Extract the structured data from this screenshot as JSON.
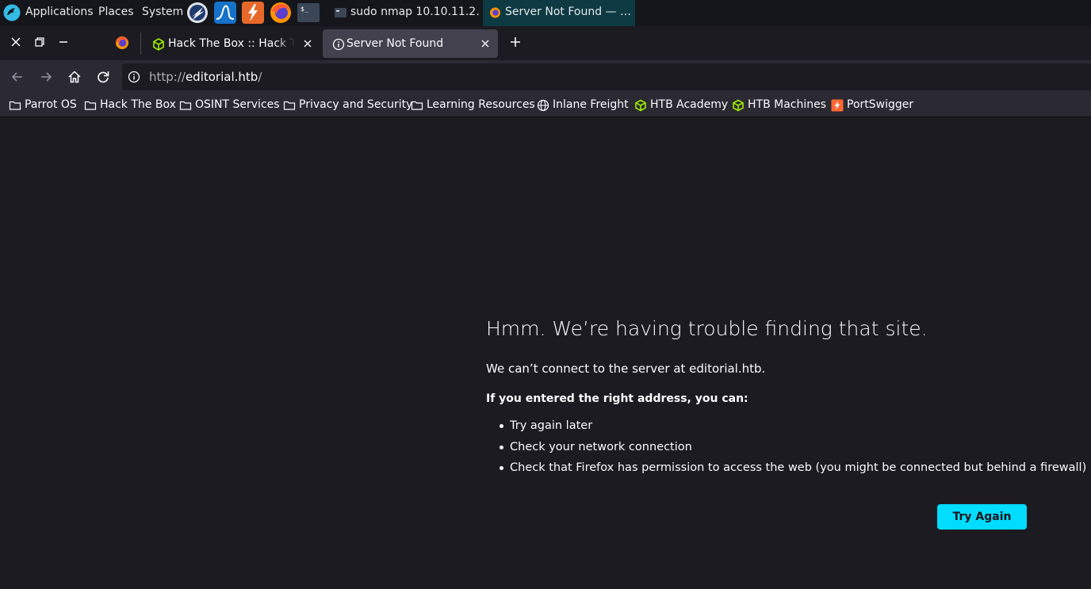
{
  "panel": {
    "menus": [
      "Applications",
      "Places",
      "System"
    ],
    "launchers": [
      "burp-suite-icon",
      "wireshark-icon",
      "zap-proxy-icon",
      "firefox-icon",
      "terminal-icon"
    ],
    "tasks": [
      {
        "label": "sudo nmap 10.10.11.2…",
        "icon": "terminal-icon"
      },
      {
        "label": "Server Not Found — …",
        "icon": "firefox-icon",
        "active": true
      }
    ]
  },
  "tabs": [
    {
      "title": "Hack The Box :: Hack The Box",
      "icon": "htb-cube-icon"
    },
    {
      "title": "Server Not Found",
      "icon": "info-icon",
      "active": true
    }
  ],
  "nav": {
    "url_scheme": "http://",
    "url_host": "editorial.htb",
    "url_path": "/"
  },
  "bookmarks": [
    {
      "label": "Parrot OS",
      "icon": "folder-icon"
    },
    {
      "label": "Hack The Box",
      "icon": "folder-icon"
    },
    {
      "label": "OSINT Services",
      "icon": "folder-icon"
    },
    {
      "label": "Privacy and Security",
      "icon": "folder-icon"
    },
    {
      "label": "Learning Resources",
      "icon": "folder-icon"
    },
    {
      "label": "Inlane Freight",
      "icon": "globe-icon"
    },
    {
      "label": "HTB Academy",
      "icon": "htb-cube-icon"
    },
    {
      "label": "HTB Machines",
      "icon": "htb-cube-icon"
    },
    {
      "label": "PortSwigger",
      "icon": "portswigger-icon"
    }
  ],
  "error": {
    "title": "Hmm. We’re having trouble finding that site.",
    "description": "We can’t connect to the server at editorial.htb.",
    "hint": "If you entered the right address, you can:",
    "suggestions": [
      "Try again later",
      "Check your network connection",
      "Check that Firefox has permission to access the web (you might be connected but behind a firewall)"
    ],
    "button": "Try Again"
  },
  "colors": {
    "page_bg": "#1c1b22",
    "toolbar_bg": "#2b2a33",
    "accent_button": "#00ddff",
    "htb_green": "#9fef00"
  }
}
